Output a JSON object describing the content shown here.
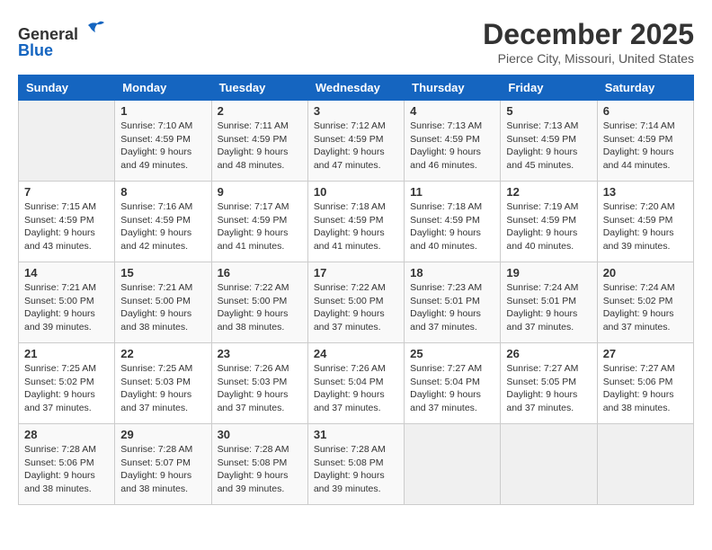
{
  "header": {
    "logo_line1": "General",
    "logo_line2": "Blue",
    "month": "December 2025",
    "location": "Pierce City, Missouri, United States"
  },
  "days_of_week": [
    "Sunday",
    "Monday",
    "Tuesday",
    "Wednesday",
    "Thursday",
    "Friday",
    "Saturday"
  ],
  "weeks": [
    [
      {
        "day": "",
        "empty": true
      },
      {
        "day": "1",
        "sunrise": "Sunrise: 7:10 AM",
        "sunset": "Sunset: 4:59 PM",
        "daylight": "Daylight: 9 hours and 49 minutes."
      },
      {
        "day": "2",
        "sunrise": "Sunrise: 7:11 AM",
        "sunset": "Sunset: 4:59 PM",
        "daylight": "Daylight: 9 hours and 48 minutes."
      },
      {
        "day": "3",
        "sunrise": "Sunrise: 7:12 AM",
        "sunset": "Sunset: 4:59 PM",
        "daylight": "Daylight: 9 hours and 47 minutes."
      },
      {
        "day": "4",
        "sunrise": "Sunrise: 7:13 AM",
        "sunset": "Sunset: 4:59 PM",
        "daylight": "Daylight: 9 hours and 46 minutes."
      },
      {
        "day": "5",
        "sunrise": "Sunrise: 7:13 AM",
        "sunset": "Sunset: 4:59 PM",
        "daylight": "Daylight: 9 hours and 45 minutes."
      },
      {
        "day": "6",
        "sunrise": "Sunrise: 7:14 AM",
        "sunset": "Sunset: 4:59 PM",
        "daylight": "Daylight: 9 hours and 44 minutes."
      }
    ],
    [
      {
        "day": "7",
        "sunrise": "Sunrise: 7:15 AM",
        "sunset": "Sunset: 4:59 PM",
        "daylight": "Daylight: 9 hours and 43 minutes."
      },
      {
        "day": "8",
        "sunrise": "Sunrise: 7:16 AM",
        "sunset": "Sunset: 4:59 PM",
        "daylight": "Daylight: 9 hours and 42 minutes."
      },
      {
        "day": "9",
        "sunrise": "Sunrise: 7:17 AM",
        "sunset": "Sunset: 4:59 PM",
        "daylight": "Daylight: 9 hours and 41 minutes."
      },
      {
        "day": "10",
        "sunrise": "Sunrise: 7:18 AM",
        "sunset": "Sunset: 4:59 PM",
        "daylight": "Daylight: 9 hours and 41 minutes."
      },
      {
        "day": "11",
        "sunrise": "Sunrise: 7:18 AM",
        "sunset": "Sunset: 4:59 PM",
        "daylight": "Daylight: 9 hours and 40 minutes."
      },
      {
        "day": "12",
        "sunrise": "Sunrise: 7:19 AM",
        "sunset": "Sunset: 4:59 PM",
        "daylight": "Daylight: 9 hours and 40 minutes."
      },
      {
        "day": "13",
        "sunrise": "Sunrise: 7:20 AM",
        "sunset": "Sunset: 4:59 PM",
        "daylight": "Daylight: 9 hours and 39 minutes."
      }
    ],
    [
      {
        "day": "14",
        "sunrise": "Sunrise: 7:21 AM",
        "sunset": "Sunset: 5:00 PM",
        "daylight": "Daylight: 9 hours and 39 minutes."
      },
      {
        "day": "15",
        "sunrise": "Sunrise: 7:21 AM",
        "sunset": "Sunset: 5:00 PM",
        "daylight": "Daylight: 9 hours and 38 minutes."
      },
      {
        "day": "16",
        "sunrise": "Sunrise: 7:22 AM",
        "sunset": "Sunset: 5:00 PM",
        "daylight": "Daylight: 9 hours and 38 minutes."
      },
      {
        "day": "17",
        "sunrise": "Sunrise: 7:22 AM",
        "sunset": "Sunset: 5:00 PM",
        "daylight": "Daylight: 9 hours and 37 minutes."
      },
      {
        "day": "18",
        "sunrise": "Sunrise: 7:23 AM",
        "sunset": "Sunset: 5:01 PM",
        "daylight": "Daylight: 9 hours and 37 minutes."
      },
      {
        "day": "19",
        "sunrise": "Sunrise: 7:24 AM",
        "sunset": "Sunset: 5:01 PM",
        "daylight": "Daylight: 9 hours and 37 minutes."
      },
      {
        "day": "20",
        "sunrise": "Sunrise: 7:24 AM",
        "sunset": "Sunset: 5:02 PM",
        "daylight": "Daylight: 9 hours and 37 minutes."
      }
    ],
    [
      {
        "day": "21",
        "sunrise": "Sunrise: 7:25 AM",
        "sunset": "Sunset: 5:02 PM",
        "daylight": "Daylight: 9 hours and 37 minutes."
      },
      {
        "day": "22",
        "sunrise": "Sunrise: 7:25 AM",
        "sunset": "Sunset: 5:03 PM",
        "daylight": "Daylight: 9 hours and 37 minutes."
      },
      {
        "day": "23",
        "sunrise": "Sunrise: 7:26 AM",
        "sunset": "Sunset: 5:03 PM",
        "daylight": "Daylight: 9 hours and 37 minutes."
      },
      {
        "day": "24",
        "sunrise": "Sunrise: 7:26 AM",
        "sunset": "Sunset: 5:04 PM",
        "daylight": "Daylight: 9 hours and 37 minutes."
      },
      {
        "day": "25",
        "sunrise": "Sunrise: 7:27 AM",
        "sunset": "Sunset: 5:04 PM",
        "daylight": "Daylight: 9 hours and 37 minutes."
      },
      {
        "day": "26",
        "sunrise": "Sunrise: 7:27 AM",
        "sunset": "Sunset: 5:05 PM",
        "daylight": "Daylight: 9 hours and 37 minutes."
      },
      {
        "day": "27",
        "sunrise": "Sunrise: 7:27 AM",
        "sunset": "Sunset: 5:06 PM",
        "daylight": "Daylight: 9 hours and 38 minutes."
      }
    ],
    [
      {
        "day": "28",
        "sunrise": "Sunrise: 7:28 AM",
        "sunset": "Sunset: 5:06 PM",
        "daylight": "Daylight: 9 hours and 38 minutes."
      },
      {
        "day": "29",
        "sunrise": "Sunrise: 7:28 AM",
        "sunset": "Sunset: 5:07 PM",
        "daylight": "Daylight: 9 hours and 38 minutes."
      },
      {
        "day": "30",
        "sunrise": "Sunrise: 7:28 AM",
        "sunset": "Sunset: 5:08 PM",
        "daylight": "Daylight: 9 hours and 39 minutes."
      },
      {
        "day": "31",
        "sunrise": "Sunrise: 7:28 AM",
        "sunset": "Sunset: 5:08 PM",
        "daylight": "Daylight: 9 hours and 39 minutes."
      },
      {
        "day": "",
        "empty": true
      },
      {
        "day": "",
        "empty": true
      },
      {
        "day": "",
        "empty": true
      }
    ]
  ]
}
